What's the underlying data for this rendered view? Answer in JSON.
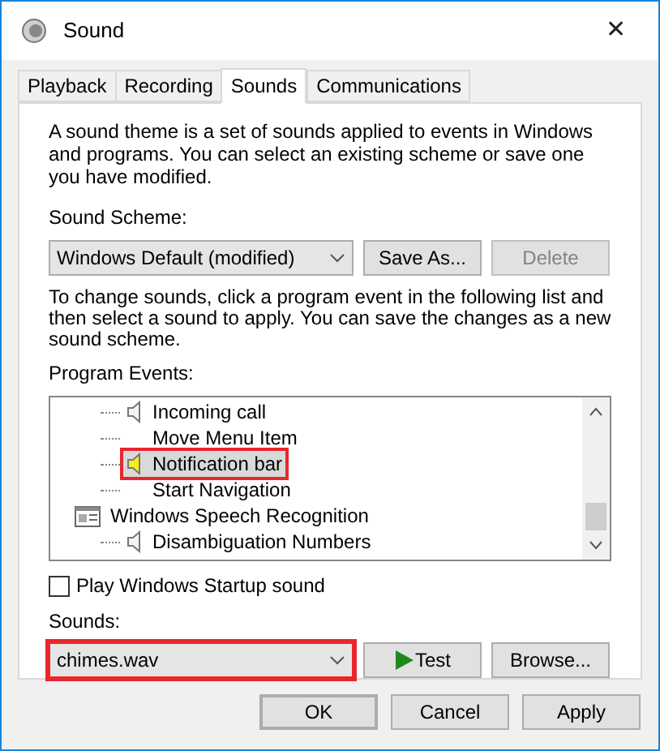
{
  "window": {
    "title": "Sound",
    "close": "✕"
  },
  "tabs": [
    {
      "label": "Playback",
      "selected": false
    },
    {
      "label": "Recording",
      "selected": false
    },
    {
      "label": "Sounds",
      "selected": true
    },
    {
      "label": "Communications",
      "selected": false
    }
  ],
  "intro": "A sound theme is a set of sounds applied to events in Windows and programs.  You can select an existing scheme or save one you have modified.",
  "scheme": {
    "label": "Sound Scheme:",
    "value": "Windows Default (modified)"
  },
  "scheme_buttons": [
    {
      "label": "Save As...",
      "disabled": false
    },
    {
      "label": "Delete",
      "disabled": true
    }
  ],
  "instructions": "To change sounds, click a program event in the following list and then select a sound to apply.  You can save the changes as a new sound scheme.",
  "events": {
    "label": "Program Events:",
    "tree": [
      {
        "children": [
          {
            "label": "Incoming call",
            "kind": "sound",
            "selected": false,
            "highlighted": false
          },
          {
            "label": "Move Menu Item",
            "kind": "plain",
            "selected": false,
            "highlighted": false
          },
          {
            "label": "Notification bar",
            "kind": "sound",
            "selected": true,
            "highlighted": true
          },
          {
            "label": "Start Navigation",
            "kind": "plain",
            "selected": false,
            "highlighted": false
          }
        ]
      },
      {
        "label": "Windows Speech Recognition",
        "kind": "app",
        "selected": false,
        "highlighted": false,
        "children": [
          {
            "label": "Disambiguation Numbers",
            "kind": "sound",
            "selected": false,
            "highlighted": false
          }
        ]
      }
    ]
  },
  "startup": {
    "label": "Play Windows Startup sound",
    "checked": false
  },
  "sounds": {
    "label": "Sounds:",
    "value": "chimes.wav",
    "highlighted": true
  },
  "sound_buttons": [
    {
      "label": "Test",
      "kind": "play"
    },
    {
      "label": "Browse...",
      "kind": "plain"
    }
  ],
  "footer": [
    {
      "label": "OK",
      "default": true
    },
    {
      "label": "Cancel",
      "default": false
    },
    {
      "label": "Apply",
      "default": false
    }
  ]
}
